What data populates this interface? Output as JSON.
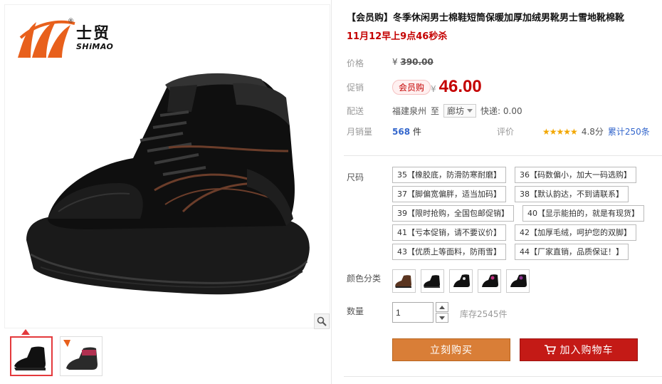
{
  "brand": {
    "name_cn": "士贸",
    "name_en": "SHiMAO",
    "reg": "®"
  },
  "product": {
    "title": "【会员购】冬季休闲男士棉鞋短筒保暖加厚加绒男靴男士雪地靴棉靴",
    "promo": "11月12早上9点46秒杀"
  },
  "price": {
    "orig_label": "价格",
    "orig_currency": "¥",
    "orig_value": "390.00",
    "promo_label": "促销",
    "member_badge": "会员购",
    "currency": "¥",
    "value": "46.00"
  },
  "shipping": {
    "label": "配送",
    "from": "福建泉州",
    "to_word": "至",
    "dest": "廊坊",
    "express": "快递: 0.00"
  },
  "sales": {
    "label": "月销量",
    "count": "568",
    "unit": "件",
    "rating_label": "评价",
    "stars": "★★★★★",
    "score": "4.8分",
    "reviews": "累计250条"
  },
  "sizes": {
    "label": "尺码",
    "options": [
      "35【橡胶底，防滑防寒耐磨】",
      "36【码数偏小，加大一码选购】",
      "37【脚偏宽偏胖，适当加码】",
      "38【默认韵达，不到请联系】",
      "39【限时抢购，全国包邮促销】",
      "40【显示能拍的，就是有现货】",
      "41【亏本促销，请不要议价】",
      "42【加厚毛绒，呵护您的双脚】",
      "43【优质上等面料，防雨雪】",
      "44【厂家直销，品质保证！】"
    ]
  },
  "colors": {
    "label": "颜色分类",
    "count": 5
  },
  "quantity": {
    "label": "数量",
    "value": "1",
    "stock": "库存2545件"
  },
  "actions": {
    "buy": "立刻购买",
    "cart": "加入购物车"
  }
}
